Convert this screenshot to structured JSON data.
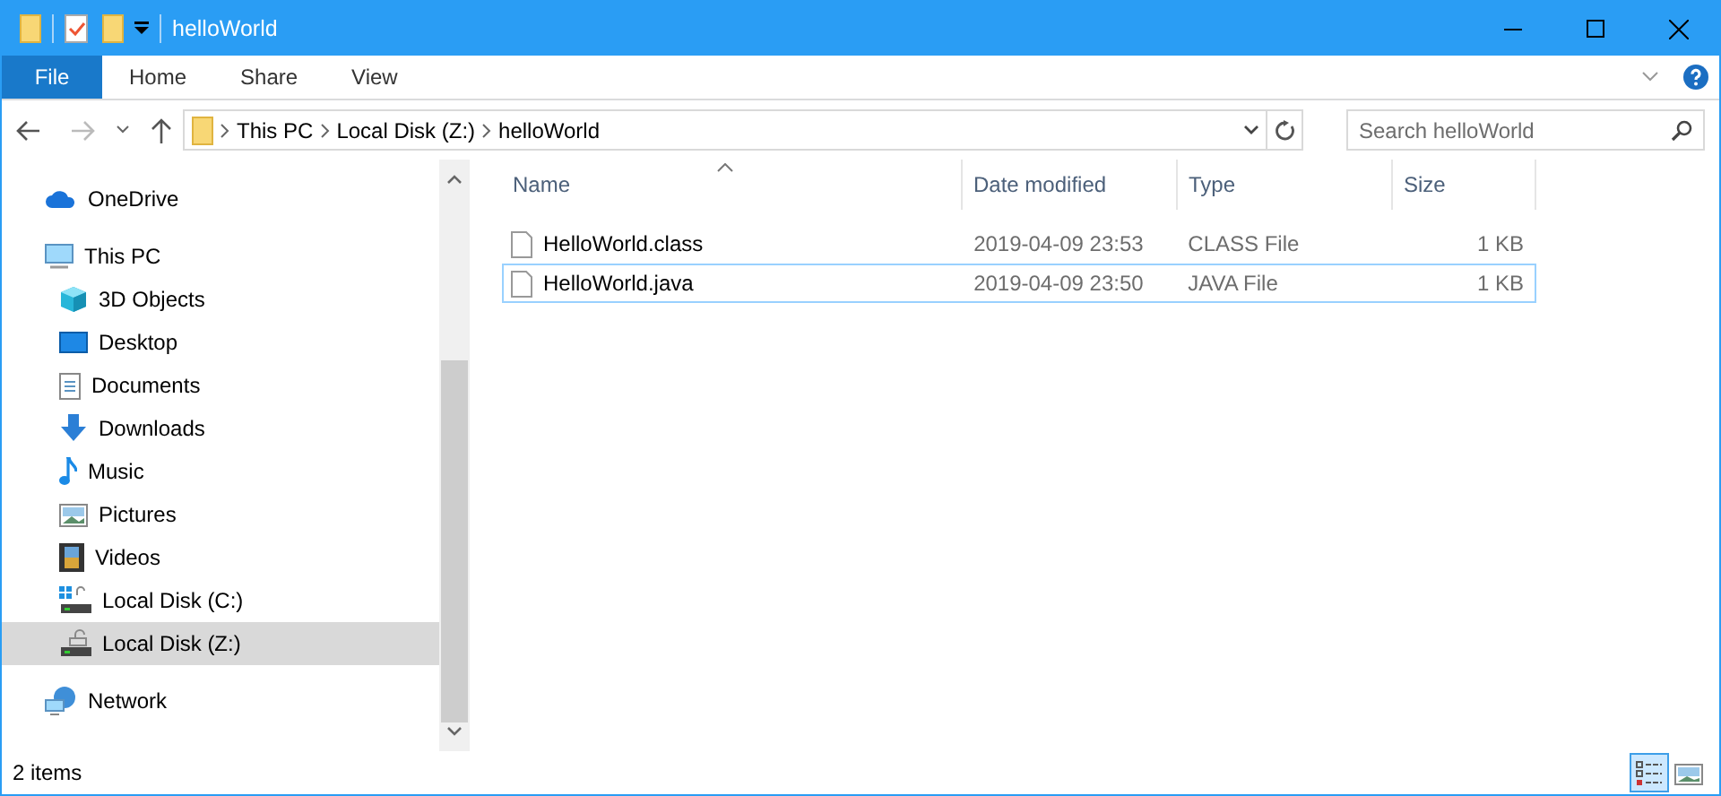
{
  "window": {
    "title": "helloWorld"
  },
  "ribbon_tabs": [
    {
      "label": "File",
      "kind": "menu"
    },
    {
      "label": "Home",
      "kind": "tab"
    },
    {
      "label": "Share",
      "kind": "tab"
    },
    {
      "label": "View",
      "kind": "tab"
    }
  ],
  "address_bar": {
    "path": [
      "This PC",
      "Local Disk (Z:)",
      "helloWorld"
    ]
  },
  "search": {
    "placeholder": "Search helloWorld"
  },
  "sidebar": {
    "items": [
      {
        "label": "OneDrive",
        "kind": "cloud",
        "selected": false
      },
      {
        "label": "This PC",
        "kind": "computer",
        "selected": false,
        "children": [
          {
            "label": "3D Objects",
            "kind": "cube",
            "selected": false
          },
          {
            "label": "Desktop",
            "kind": "desktop",
            "selected": false
          },
          {
            "label": "Documents",
            "kind": "document",
            "selected": false
          },
          {
            "label": "Downloads",
            "kind": "download",
            "selected": false
          },
          {
            "label": "Music",
            "kind": "music",
            "selected": false
          },
          {
            "label": "Pictures",
            "kind": "pictures",
            "selected": false
          },
          {
            "label": "Videos",
            "kind": "videos",
            "selected": false
          },
          {
            "label": "Local Disk (C:)",
            "kind": "system-drive",
            "selected": false
          },
          {
            "label": "Local Disk (Z:)",
            "kind": "drive",
            "selected": true
          }
        ]
      },
      {
        "label": "Network",
        "kind": "network",
        "selected": false
      }
    ]
  },
  "file_list": {
    "columns": [
      "Name",
      "Date modified",
      "Type",
      "Size"
    ],
    "rows": [
      {
        "name": "HelloWorld.class",
        "date_modified": "2019-04-09 23:53",
        "type": "CLASS File",
        "size": "1 KB",
        "focused": false
      },
      {
        "name": "HelloWorld.java",
        "date_modified": "2019-04-09 23:50",
        "type": "JAVA File",
        "size": "1 KB",
        "focused": true
      }
    ]
  },
  "status_bar": {
    "text": "2 items",
    "views": [
      {
        "kind": "details",
        "selected": true
      },
      {
        "kind": "large-icons",
        "selected": false
      }
    ]
  }
}
